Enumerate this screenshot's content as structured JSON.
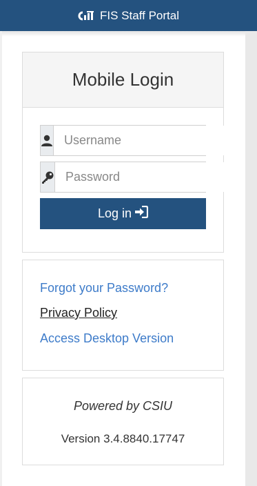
{
  "header": {
    "title": "FIS Staff Portal",
    "logo_icon": "csiu-logo-icon",
    "bg_color": "#24527f"
  },
  "login": {
    "title": "Mobile Login",
    "username_placeholder": "Username",
    "username_icon": "user-icon",
    "password_placeholder": "Password",
    "password_icon": "key-icon",
    "button_label": "Log in",
    "button_icon": "sign-in-icon"
  },
  "links": {
    "forgot": "Forgot your Password?",
    "privacy": "Privacy Policy",
    "desktop": "Access Desktop Version",
    "link_color": "#3d7bc9"
  },
  "footer": {
    "powered": "Powered by CSIU",
    "version": "Version 3.4.8840.17747"
  }
}
